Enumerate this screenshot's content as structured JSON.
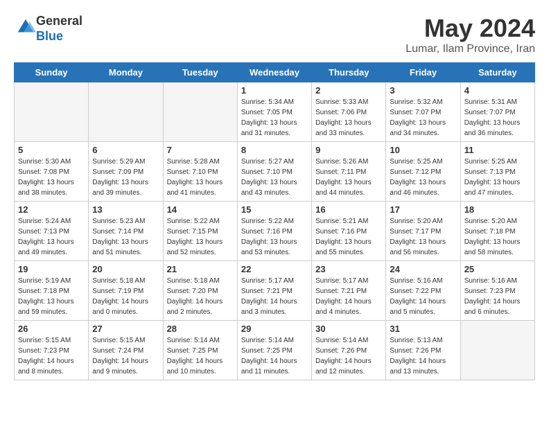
{
  "logo": {
    "general": "General",
    "blue": "Blue"
  },
  "header": {
    "month": "May 2024",
    "location": "Lumar, Ilam Province, Iran"
  },
  "days_of_week": [
    "Sunday",
    "Monday",
    "Tuesday",
    "Wednesday",
    "Thursday",
    "Friday",
    "Saturday"
  ],
  "weeks": [
    {
      "alt": false,
      "days": [
        {
          "num": "",
          "empty": true
        },
        {
          "num": "",
          "empty": true
        },
        {
          "num": "",
          "empty": true
        },
        {
          "num": "1",
          "sunrise": "5:34 AM",
          "sunset": "7:05 PM",
          "daylight": "13 hours and 31 minutes."
        },
        {
          "num": "2",
          "sunrise": "5:33 AM",
          "sunset": "7:06 PM",
          "daylight": "13 hours and 33 minutes."
        },
        {
          "num": "3",
          "sunrise": "5:32 AM",
          "sunset": "7:07 PM",
          "daylight": "13 hours and 34 minutes."
        },
        {
          "num": "4",
          "sunrise": "5:31 AM",
          "sunset": "7:07 PM",
          "daylight": "13 hours and 36 minutes."
        }
      ]
    },
    {
      "alt": true,
      "days": [
        {
          "num": "5",
          "sunrise": "5:30 AM",
          "sunset": "7:08 PM",
          "daylight": "13 hours and 38 minutes."
        },
        {
          "num": "6",
          "sunrise": "5:29 AM",
          "sunset": "7:09 PM",
          "daylight": "13 hours and 39 minutes."
        },
        {
          "num": "7",
          "sunrise": "5:28 AM",
          "sunset": "7:10 PM",
          "daylight": "13 hours and 41 minutes."
        },
        {
          "num": "8",
          "sunrise": "5:27 AM",
          "sunset": "7:10 PM",
          "daylight": "13 hours and 43 minutes."
        },
        {
          "num": "9",
          "sunrise": "5:26 AM",
          "sunset": "7:11 PM",
          "daylight": "13 hours and 44 minutes."
        },
        {
          "num": "10",
          "sunrise": "5:25 AM",
          "sunset": "7:12 PM",
          "daylight": "13 hours and 46 minutes."
        },
        {
          "num": "11",
          "sunrise": "5:25 AM",
          "sunset": "7:13 PM",
          "daylight": "13 hours and 47 minutes."
        }
      ]
    },
    {
      "alt": false,
      "days": [
        {
          "num": "12",
          "sunrise": "5:24 AM",
          "sunset": "7:13 PM",
          "daylight": "13 hours and 49 minutes."
        },
        {
          "num": "13",
          "sunrise": "5:23 AM",
          "sunset": "7:14 PM",
          "daylight": "13 hours and 51 minutes."
        },
        {
          "num": "14",
          "sunrise": "5:22 AM",
          "sunset": "7:15 PM",
          "daylight": "13 hours and 52 minutes."
        },
        {
          "num": "15",
          "sunrise": "5:22 AM",
          "sunset": "7:16 PM",
          "daylight": "13 hours and 53 minutes."
        },
        {
          "num": "16",
          "sunrise": "5:21 AM",
          "sunset": "7:16 PM",
          "daylight": "13 hours and 55 minutes."
        },
        {
          "num": "17",
          "sunrise": "5:20 AM",
          "sunset": "7:17 PM",
          "daylight": "13 hours and 56 minutes."
        },
        {
          "num": "18",
          "sunrise": "5:20 AM",
          "sunset": "7:18 PM",
          "daylight": "13 hours and 58 minutes."
        }
      ]
    },
    {
      "alt": true,
      "days": [
        {
          "num": "19",
          "sunrise": "5:19 AM",
          "sunset": "7:18 PM",
          "daylight": "13 hours and 59 minutes."
        },
        {
          "num": "20",
          "sunrise": "5:18 AM",
          "sunset": "7:19 PM",
          "daylight": "14 hours and 0 minutes."
        },
        {
          "num": "21",
          "sunrise": "5:18 AM",
          "sunset": "7:20 PM",
          "daylight": "14 hours and 2 minutes."
        },
        {
          "num": "22",
          "sunrise": "5:17 AM",
          "sunset": "7:21 PM",
          "daylight": "14 hours and 3 minutes."
        },
        {
          "num": "23",
          "sunrise": "5:17 AM",
          "sunset": "7:21 PM",
          "daylight": "14 hours and 4 minutes."
        },
        {
          "num": "24",
          "sunrise": "5:16 AM",
          "sunset": "7:22 PM",
          "daylight": "14 hours and 5 minutes."
        },
        {
          "num": "25",
          "sunrise": "5:16 AM",
          "sunset": "7:23 PM",
          "daylight": "14 hours and 6 minutes."
        }
      ]
    },
    {
      "alt": false,
      "days": [
        {
          "num": "26",
          "sunrise": "5:15 AM",
          "sunset": "7:23 PM",
          "daylight": "14 hours and 8 minutes."
        },
        {
          "num": "27",
          "sunrise": "5:15 AM",
          "sunset": "7:24 PM",
          "daylight": "14 hours and 9 minutes."
        },
        {
          "num": "28",
          "sunrise": "5:14 AM",
          "sunset": "7:25 PM",
          "daylight": "14 hours and 10 minutes."
        },
        {
          "num": "29",
          "sunrise": "5:14 AM",
          "sunset": "7:25 PM",
          "daylight": "14 hours and 11 minutes."
        },
        {
          "num": "30",
          "sunrise": "5:14 AM",
          "sunset": "7:26 PM",
          "daylight": "14 hours and 12 minutes."
        },
        {
          "num": "31",
          "sunrise": "5:13 AM",
          "sunset": "7:26 PM",
          "daylight": "14 hours and 13 minutes."
        },
        {
          "num": "",
          "empty": true
        }
      ]
    }
  ]
}
